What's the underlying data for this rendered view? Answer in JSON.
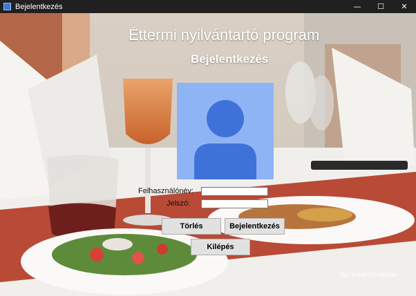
{
  "window": {
    "title": "Bejelentkezés",
    "controls": {
      "minimize": "—",
      "maximize": "☐",
      "close": "✕"
    }
  },
  "header": {
    "title": "Éttermi nyilvántartó program",
    "subtitle": "Bejelentkezés"
  },
  "form": {
    "username_label": "Felhasználónév:",
    "username_value": "",
    "password_label": "Jelszó:",
    "password_value": ""
  },
  "buttons": {
    "clear_label": "Törlés",
    "login_label": "Bejelentkezés",
    "exit_label": "Kilépés"
  },
  "footer": {
    "credit": "by: Hadházi István"
  },
  "colors": {
    "avatar_bg": "#8fb4f5",
    "avatar_figure": "#3f72d9",
    "input_focus_border": "#2d7bd8"
  },
  "icons": {
    "app": "app-window-icon",
    "avatar": "user-avatar-icon"
  }
}
